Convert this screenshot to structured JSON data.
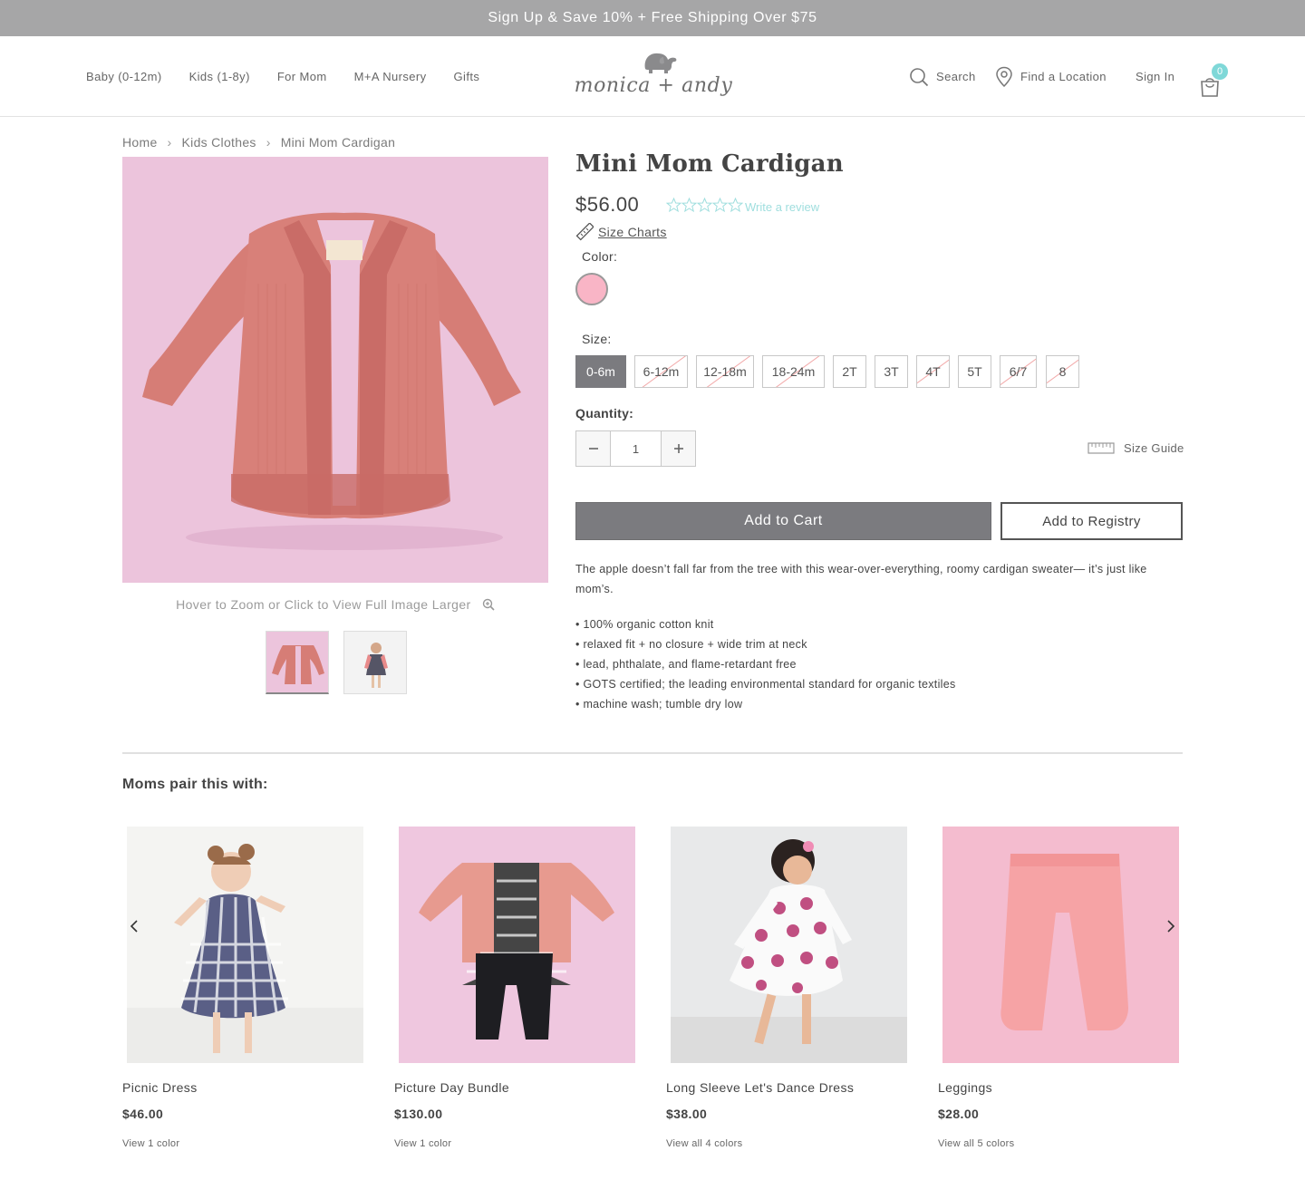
{
  "promo": {
    "text": "Sign Up & Save 10% + Free Shipping Over $75"
  },
  "header": {
    "nav": [
      "Baby (0-12m)",
      "Kids (1-8y)",
      "For Mom",
      "M+A Nursery",
      "Gifts"
    ],
    "logo_text": "monica + andy",
    "search_label": "Search",
    "location_label": "Find a Location",
    "signin_label": "Sign In",
    "cart_count": "0"
  },
  "breadcrumb": [
    "Home",
    "Kids Clothes",
    "Mini Mom Cardigan"
  ],
  "gallery": {
    "zoom_hint": "Hover to Zoom or Click to View Full Image Larger"
  },
  "product": {
    "title": "Mini Mom Cardigan",
    "price": "$56.00",
    "rating_stars": 0,
    "review_link": "Write a review",
    "size_charts": "Size Charts",
    "color_label": "Color:",
    "color_swatch": "#f9b5c6",
    "size_label": "Size:",
    "sizes": [
      {
        "label": "0-6m",
        "state": "selected"
      },
      {
        "label": "6-12m",
        "state": "unavailable"
      },
      {
        "label": "12-18m",
        "state": "unavailable"
      },
      {
        "label": "18-24m",
        "state": "unavailable"
      },
      {
        "label": "2T",
        "state": "available"
      },
      {
        "label": "3T",
        "state": "available"
      },
      {
        "label": "4T",
        "state": "unavailable"
      },
      {
        "label": "5T",
        "state": "available"
      },
      {
        "label": "6/7",
        "state": "unavailable"
      },
      {
        "label": "8",
        "state": "unavailable"
      }
    ],
    "quantity_label": "Quantity:",
    "quantity": "1",
    "size_guide": "Size Guide",
    "add_to_cart": "Add to Cart",
    "add_to_registry": "Add to Registry",
    "description": "The apple doesn’t fall far from the tree with this wear-over-everything, roomy cardigan sweater— it’s just like mom’s.",
    "features": [
      "• 100% organic cotton knit",
      "• relaxed fit + no closure + wide trim at neck",
      "• lead, phthalate, and flame-retardant free",
      "• GOTS certified; the leading environmental standard for organic textiles",
      "• machine wash; tumble dry low"
    ]
  },
  "related": {
    "title": "Moms pair this with:",
    "items": [
      {
        "name": "Picnic Dress",
        "price": "$46.00",
        "colors": "View 1 color"
      },
      {
        "name": "Picture Day Bundle",
        "price": "$130.00",
        "colors": "View 1 color"
      },
      {
        "name": "Long Sleeve Let's Dance Dress",
        "price": "$38.00",
        "colors": "View all 4 colors"
      },
      {
        "name": "Leggings",
        "price": "$28.00",
        "colors": "View all 5 colors"
      }
    ]
  },
  "colors": {
    "accent": "#7fd8d8",
    "button_gray": "#7b7b7f",
    "promo_bg": "#a6a6a7",
    "image_pink": "#ecc3dc"
  }
}
